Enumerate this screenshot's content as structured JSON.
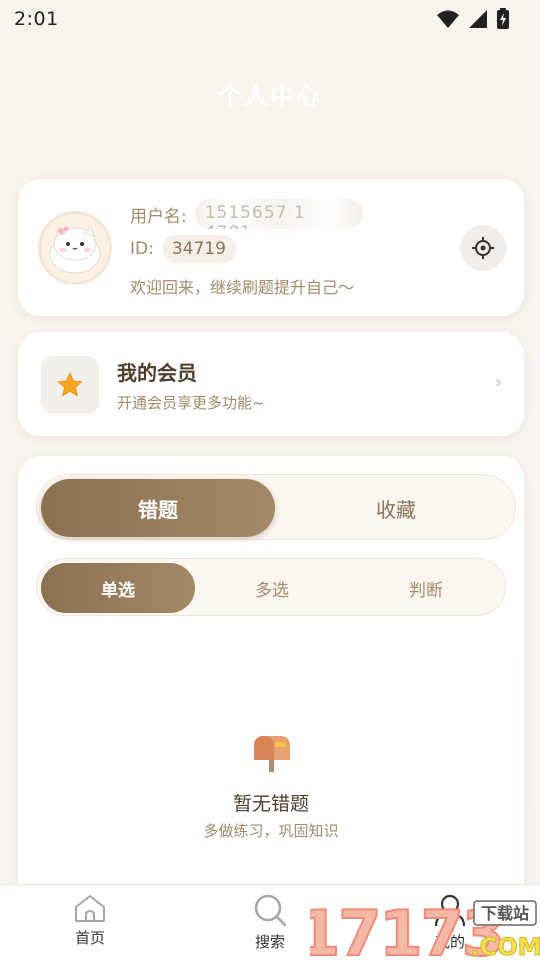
{
  "status_bar": {
    "time": "2:01",
    "icons": [
      "wifi-icon",
      "signal-icon",
      "battery-charging-icon"
    ]
  },
  "header": {
    "title": "个人中心"
  },
  "profile": {
    "username_label": "用户名:",
    "username_value": "1515657 1 4781",
    "id_label": "ID:",
    "id_value": "34719",
    "welcome": "欢迎回来，继续刷题提升自己～"
  },
  "vip": {
    "title": "我的会员",
    "subtitle": "开通会员享更多功能~",
    "arrow": "›"
  },
  "tabs": {
    "main": [
      {
        "label": "错题",
        "active": true
      },
      {
        "label": "收藏",
        "active": false
      }
    ],
    "sub": [
      {
        "label": "单选",
        "active": true
      },
      {
        "label": "多选",
        "active": false
      },
      {
        "label": "判断",
        "active": false
      }
    ]
  },
  "empty_state": {
    "title": "暂无错题",
    "subtitle": "多做练习，巩固知识"
  },
  "bottom_nav": [
    {
      "label": "首页",
      "icon": "home-icon"
    },
    {
      "label": "搜索",
      "icon": "search-icon"
    },
    {
      "label": "我的",
      "icon": "user-icon"
    }
  ],
  "watermark": {
    "text": "17173",
    "tag": "下载站",
    "domain": ".COM"
  },
  "colors": {
    "accent_dark": "#8b7052",
    "accent_light": "#a38a67",
    "text_brown": "#4e3d2a",
    "text_muted": "#a38a6a",
    "background": "#f8f4ef"
  }
}
